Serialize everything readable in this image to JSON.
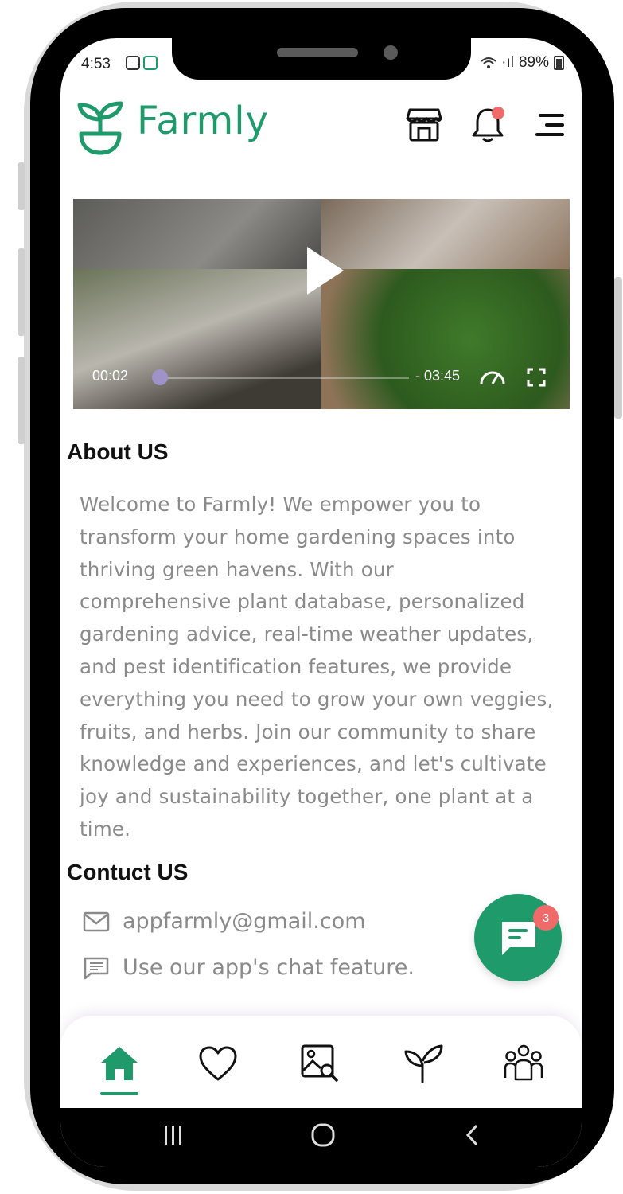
{
  "status": {
    "time": "4:53",
    "signal": "·ıl",
    "battery": "89%"
  },
  "header": {
    "brand": "Farmly"
  },
  "video": {
    "elapsed": "00:02",
    "remaining": "- 03:45",
    "progress": 0.01
  },
  "about": {
    "title": "About US",
    "lines": [
      "Welcome to Farmly! We empower you to",
      "transform your home gardening spaces into",
      "thriving green havens. With our",
      "comprehensive plant database, personalized",
      "gardening advice, real-time weather updates,",
      "and pest identification features, we provide",
      "everything you need to grow your own veggies,",
      "fruits, and herbs. Join our community to share",
      "knowledge and experiences, and let's cultivate",
      "joy and sustainability together, one plant at a",
      "time."
    ]
  },
  "contact": {
    "title": "Contuct US",
    "email": "appfarmly@gmail.com",
    "chat": "Use our app's chat feature."
  },
  "chat_fab": {
    "badge": "3"
  },
  "nav": {
    "items": [
      "home-icon",
      "heart-icon",
      "image-search-icon",
      "plant-icon",
      "community-icon"
    ],
    "active": 0
  },
  "colors": {
    "brand": "#1f9a6b",
    "badge": "#f06a6a",
    "body_text": "#8a8a8a"
  }
}
